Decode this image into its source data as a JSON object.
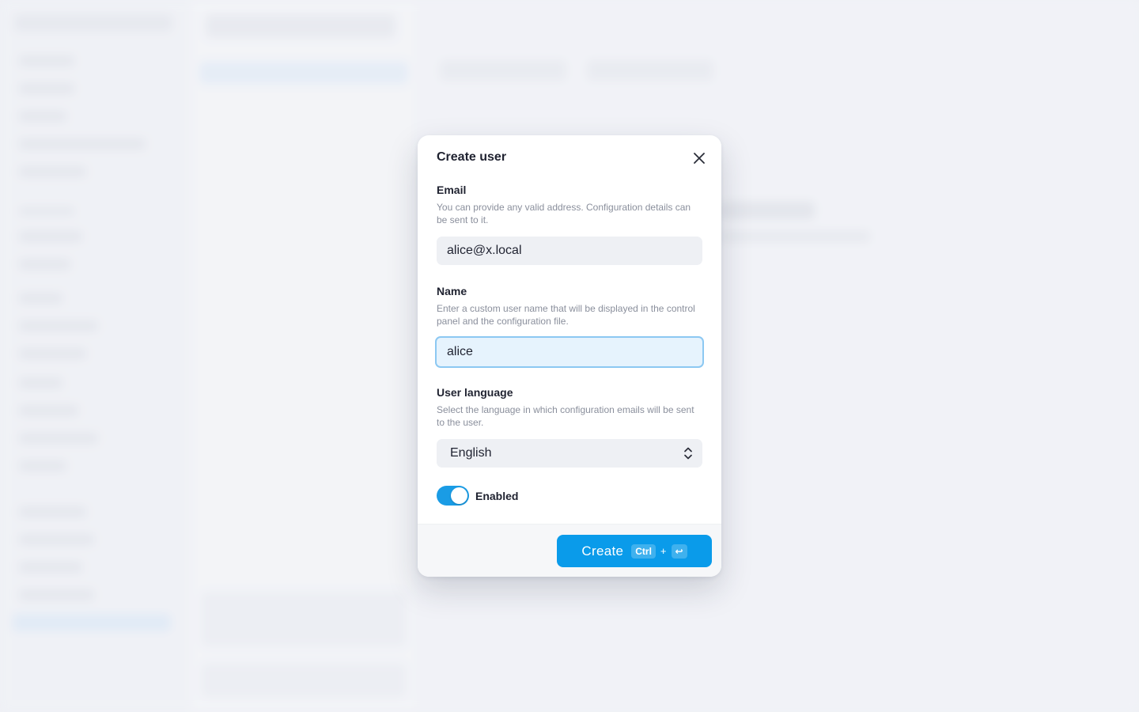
{
  "modal": {
    "title": "Create user",
    "email": {
      "label": "Email",
      "help": "You can provide any valid address. Configuration details can be sent to it.",
      "value": "alice@x.local"
    },
    "name": {
      "label": "Name",
      "help": "Enter a custom user name that will be displayed in the control panel and the configuration file.",
      "value": "alice"
    },
    "language": {
      "label": "User language",
      "help": "Select the language in which configuration emails will be sent to the user.",
      "selected": "English"
    },
    "enabled": {
      "label": "Enabled",
      "on": true
    },
    "create_button": {
      "label": "Create",
      "shortcut_key1": "Ctrl",
      "shortcut_plus": "+",
      "shortcut_key2": "↩"
    }
  },
  "colors": {
    "accent": "#0a9bea",
    "toggle_on": "#1a9ce5",
    "focus_border": "#8cc8f2"
  },
  "icons": {
    "close": "close-icon",
    "select_arrows": "chevron-up-down-icon",
    "enter": "enter-icon"
  }
}
